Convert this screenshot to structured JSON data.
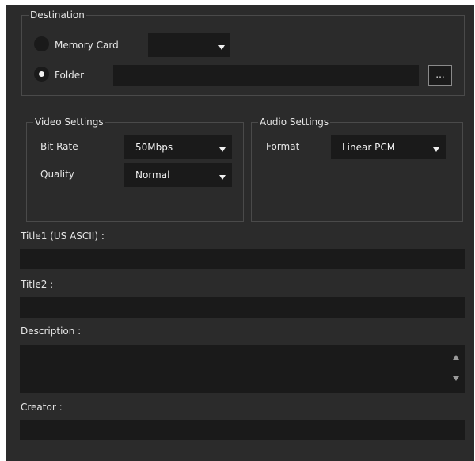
{
  "destination": {
    "title": "Destination",
    "memory_card_label": "Memory Card",
    "memory_card_value": "",
    "folder_label": "Folder",
    "folder_path": "",
    "browse_label": "...",
    "selected": "Folder"
  },
  "video_settings": {
    "title": "Video Settings",
    "bit_rate_label": "Bit Rate",
    "bit_rate_value": "50Mbps",
    "quality_label": "Quality",
    "quality_value": "Normal"
  },
  "audio_settings": {
    "title": "Audio Settings",
    "format_label": "Format",
    "format_value": "Linear PCM"
  },
  "metadata": {
    "title1_label": "Title1 (US ASCII) :",
    "title1_value": "",
    "title2_label": "Title2 :",
    "title2_value": "",
    "description_label": "Description :",
    "description_value": "",
    "creator_label": "Creator :",
    "creator_value": ""
  },
  "colors": {
    "panel_bg": "#2b2b2b",
    "field_bg": "#1a1a1a",
    "group_border": "#4a4a4a",
    "text": "#e6e6e6"
  }
}
